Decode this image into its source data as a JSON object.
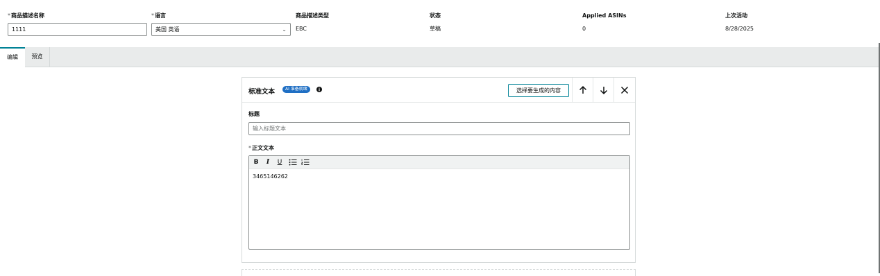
{
  "meta": {
    "name": {
      "label": "商品描述名称",
      "required": "*",
      "value": "1111"
    },
    "language": {
      "label": "语言",
      "required": "*",
      "value": "美国 英语",
      "caret": "⌄"
    },
    "type": {
      "label": "商品描述类型",
      "value": "EBC"
    },
    "status": {
      "label": "状态",
      "value": "草稿"
    },
    "asins": {
      "label": "Applied ASINs",
      "value": "0"
    },
    "last_activity": {
      "label": "上次活动",
      "value": "8/28/2025"
    }
  },
  "tabs": [
    {
      "label": "编辑",
      "active": true
    },
    {
      "label": "预览",
      "active": false
    }
  ],
  "module": {
    "title": "标准文本",
    "ai_badge": "AI 准备就绪",
    "info_icon": "info-circle-icon",
    "generate_button": "选择要生成的内容",
    "controls": [
      "arrow-up-icon",
      "arrow-down-icon",
      "close-icon"
    ],
    "headline": {
      "label": "标题",
      "placeholder": "输入标题文本"
    },
    "body": {
      "label": "正文文本",
      "required": "*",
      "toolbar": {
        "bold": "B",
        "italic": "I",
        "underline": "U",
        "bullets_icon": "bulleted-list-icon",
        "numbered_icon": "numbered-list-icon"
      },
      "text": "3465146262"
    }
  },
  "colors": {
    "accent_teal": "#008296",
    "badge_blue": "#1f6fc4",
    "tab_strip": "#e9ebeb"
  }
}
